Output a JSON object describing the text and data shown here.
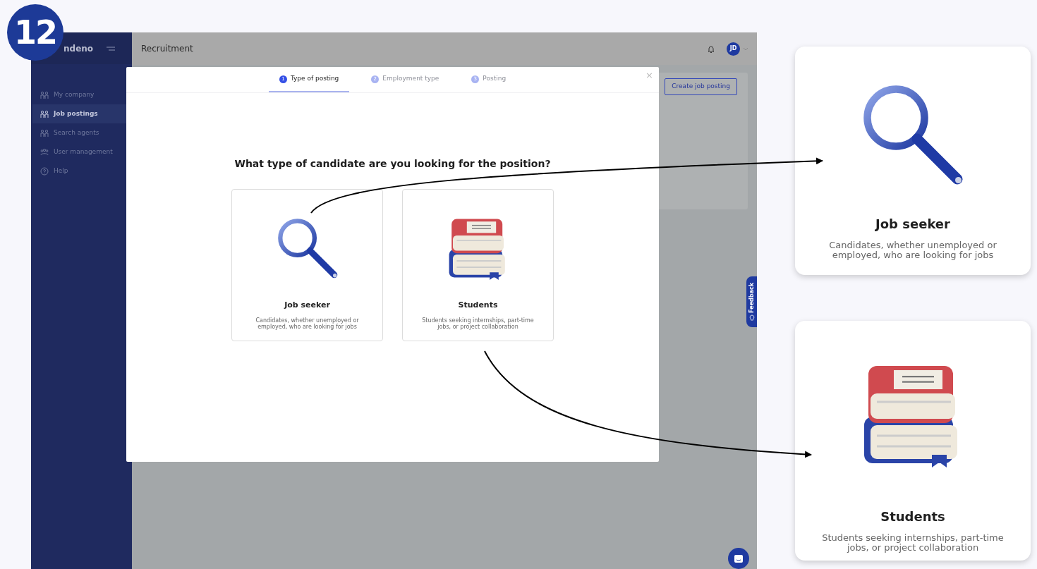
{
  "step_badge": "12",
  "app": {
    "logo": "ndeno",
    "sidebar": [
      {
        "label": "My company",
        "selected": false
      },
      {
        "label": "Job postings",
        "selected": true
      },
      {
        "label": "Search agents",
        "selected": false
      },
      {
        "label": "User management",
        "selected": false
      },
      {
        "label": "Help",
        "selected": false
      }
    ],
    "header": {
      "title": "Recruitment",
      "avatar": "JD"
    },
    "create_button": "Create job posting",
    "feedback_tab": "Feedback"
  },
  "modal": {
    "close": "×",
    "steps": [
      {
        "number": "1",
        "label": "Type of posting",
        "selected": true
      },
      {
        "number": "2",
        "label": "Employment type",
        "selected": false
      },
      {
        "number": "3",
        "label": "Posting",
        "selected": false
      }
    ],
    "question": "What type of candidate are you looking for the position?",
    "options": [
      {
        "kind": "seeker",
        "title": "Job seeker",
        "description": "Candidates, whether unemployed or employed, who are looking for jobs"
      },
      {
        "kind": "student",
        "title": "Students",
        "description": "Students seeking internships, part-time jobs, or project collaboration"
      }
    ]
  },
  "zoom_cards": [
    {
      "kind": "seeker",
      "title": "Job seeker",
      "description": "Candidates, whether unemployed or employed, who are looking for jobs"
    },
    {
      "kind": "student",
      "title": "Students",
      "description": "Students seeking internships, part-time jobs, or project collaboration"
    }
  ]
}
